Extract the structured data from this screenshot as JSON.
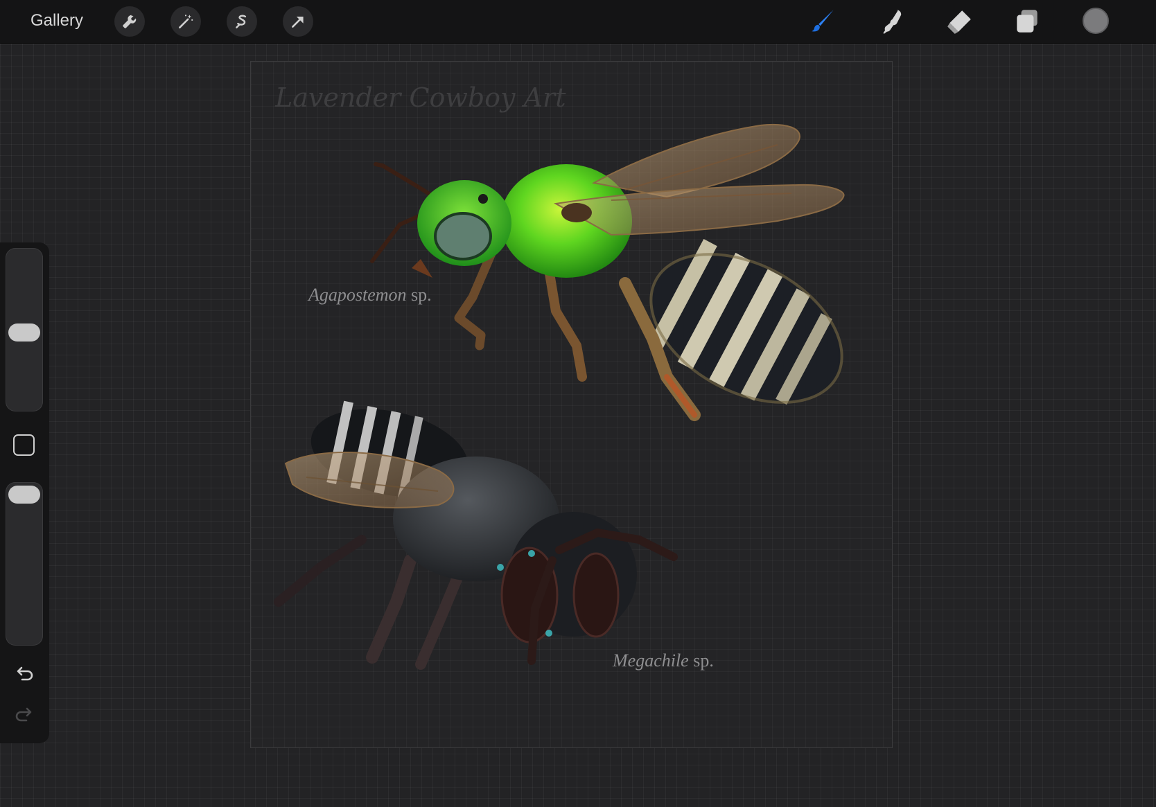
{
  "toolbar": {
    "gallery_label": "Gallery",
    "left_tools": [
      "wrench-icon",
      "magic-wand-icon",
      "selection-s-icon",
      "transform-arrow-icon"
    ],
    "right_tools": [
      "brush-icon",
      "smudge-icon",
      "eraser-icon",
      "layers-icon"
    ],
    "active_tool": "brush",
    "active_tool_color": "#1e6fe0",
    "current_color": "#7b7b7d"
  },
  "sidebar": {
    "brush_size_level": 0.52,
    "opacity_level": 0.0,
    "icons": [
      "modify-square-icon",
      "undo-icon",
      "redo-icon"
    ]
  },
  "canvas": {
    "watermark": "Lavender Cowboy Art",
    "labels": {
      "agapostemon_genus": "Agapostemon",
      "agapostemon_suffix": " sp.",
      "megachile_genus": "Megachile",
      "megachile_suffix": " sp."
    },
    "colors": {
      "green_bee": "#4fd11f",
      "dark_bee": "#2c2f33"
    }
  }
}
